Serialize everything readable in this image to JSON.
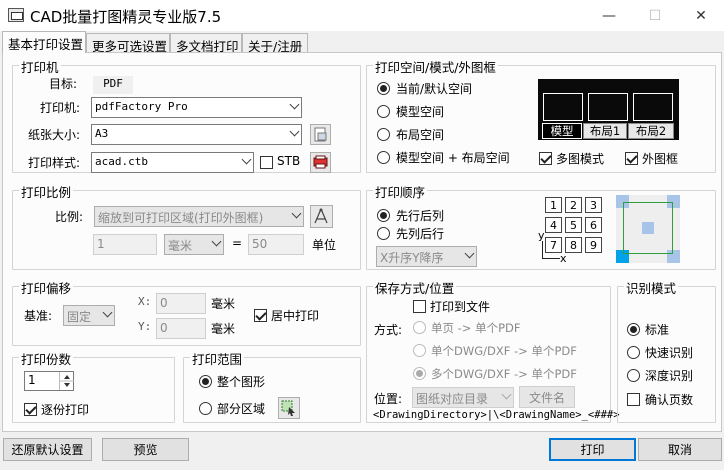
{
  "window": {
    "title": "CAD批量打图精灵专业版7.5",
    "minimize": "—",
    "maximize": "☐",
    "close": "✕"
  },
  "tabs": [
    "基本打印设置",
    "更多可选设置",
    "多文档打印",
    "关于/注册"
  ],
  "printer": {
    "group_label": "打印机",
    "target_label": "目标:",
    "target_value": "PDF",
    "printer_label": "打印机:",
    "printer_value": "pdfFactory Pro",
    "paper_label": "纸张大小:",
    "paper_value": "A3",
    "style_label": "打印样式:",
    "style_value": "acad.ctb",
    "stb_label": "STB"
  },
  "space": {
    "group_label": "打印空间/模式/外图框",
    "options": [
      "当前/默认空间",
      "模型空间",
      "布局空间",
      "模型空间 + 布局空间"
    ],
    "tabs": [
      "模型",
      "布局1",
      "布局2"
    ],
    "multi_label": "多图模式",
    "frame_label": "外图框"
  },
  "scale": {
    "group_label": "打印比例",
    "label": "比例:",
    "value": "缩放到可打印区域(打印外图框)",
    "num1": "1",
    "unit_combo": "毫米",
    "eq": "=",
    "num2": "50",
    "unit_label": "单位"
  },
  "order": {
    "group_label": "打印顺序",
    "options": [
      "先行后列",
      "先列后行"
    ],
    "sort_value": "X升序Y降序",
    "grid": [
      "1",
      "2",
      "3",
      "4",
      "5",
      "6",
      "7",
      "8",
      "9"
    ],
    "axis_y": "y",
    "axis_x": "x"
  },
  "offset": {
    "group_label": "打印偏移",
    "base_label": "基准:",
    "base_value": "固定",
    "x_label": "X:",
    "x_value": "0",
    "x_unit": "毫米",
    "y_label": "Y:",
    "y_value": "0",
    "y_unit": "毫米",
    "center_label": "居中打印"
  },
  "save": {
    "group_label": "保存方式/位置",
    "to_file_label": "打印到文件",
    "method_label": "方式:",
    "options": [
      "单页 -> 单个PDF",
      "单个DWG/DXF -> 单个PDF",
      "多个DWG/DXF -> 单个PDF"
    ],
    "location_label": "位置:",
    "location_value": "图纸对应目录",
    "filename_button": "文件名",
    "path": "<DrawingDirectory>|\\<DrawingName>_<###>"
  },
  "recognize": {
    "group_label": "识别模式",
    "options": [
      "标准",
      "快速识别",
      "深度识别"
    ],
    "confirm_label": "确认页数"
  },
  "copies": {
    "group_label": "打印份数",
    "value": "1",
    "collate_label": "逐份打印"
  },
  "range": {
    "group_label": "打印范围",
    "options": [
      "整个图形",
      "部分区域"
    ]
  },
  "footer": {
    "reset": "还原默认设置",
    "preview": "预览",
    "print": "打印",
    "cancel": "取消"
  },
  "colors": {
    "accent": "#0078d7",
    "preview_bg": "#0a0a0a",
    "frame_green": "#2e9e3e",
    "marker_blue": "#00a2e8",
    "marker_light": "#a8c4e8"
  }
}
